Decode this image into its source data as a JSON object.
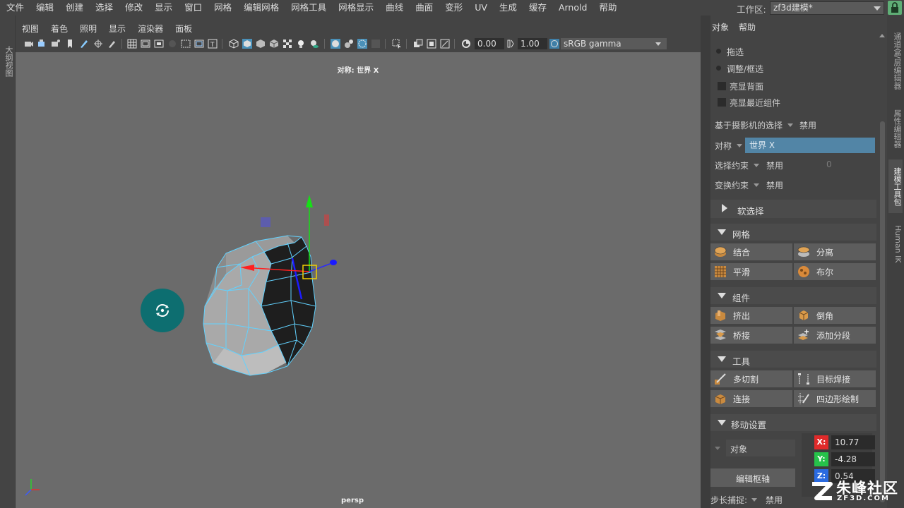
{
  "menubar": {
    "items": [
      "文件",
      "编辑",
      "创建",
      "选择",
      "修改",
      "显示",
      "窗口",
      "网格",
      "编辑网格",
      "网格工具",
      "网格显示",
      "曲线",
      "曲面",
      "变形",
      "UV",
      "生成",
      "缓存",
      "Arnold",
      "帮助"
    ],
    "workspace_label": "工作区:",
    "workspace_value": "zf3d建模*"
  },
  "left_strip": {
    "tab_label": "大纲视图"
  },
  "panel_menu": {
    "items": [
      "视图",
      "着色",
      "照明",
      "显示",
      "渲染器",
      "面板"
    ]
  },
  "toolbar": {
    "exposure_value": "0.00",
    "gamma_value": "1.00",
    "colorspace": "sRGB gamma"
  },
  "viewport": {
    "symmetry_label": "对称: 世界 X",
    "camera_name": "persp"
  },
  "right_panel": {
    "menu": [
      "对象",
      "帮助"
    ],
    "radio_drag": "拖选",
    "radio_adjust": "调整/框选",
    "check_backface": "亮显背面",
    "check_nearest": "亮显最近组件",
    "camera_selection_label": "基于摄影机的选择",
    "camera_selection_value": "禁用",
    "symmetry_label": "对称",
    "symmetry_value": "世界 X",
    "select_constraint_label": "选择约束",
    "select_constraint_value": "禁用",
    "select_constraint_num": "0",
    "transform_constraint_label": "变换约束",
    "transform_constraint_value": "禁用",
    "soft_select_label": "软选择",
    "sections": {
      "mesh": {
        "title": "网格",
        "buttons": [
          "结合",
          "分离",
          "平滑",
          "布尔"
        ]
      },
      "component": {
        "title": "组件",
        "buttons": [
          "挤出",
          "倒角",
          "桥接",
          "添加分段"
        ]
      },
      "tools": {
        "title": "工具",
        "buttons": [
          "多切割",
          "目标焊接",
          "连接",
          "四边形绘制"
        ]
      },
      "move": {
        "title": "移动设置",
        "object_label": "对象",
        "edit_pivot": "编辑枢轴",
        "step_label": "步长捕捉:",
        "step_value": "禁用"
      }
    },
    "coords": {
      "x_label": "X:",
      "x": "10.77",
      "y_label": "Y:",
      "y": "-4.28",
      "z_label": "Z:",
      "z": "0.54"
    }
  },
  "right_tabs": [
    "通道盒/层编辑器",
    "属性编辑器",
    "建模工具包",
    "Human IK"
  ],
  "watermark": {
    "main": "朱峰社区",
    "sub": "ZF3D.COM"
  },
  "colors": {
    "accent_blue": "#5285a6",
    "tumble_teal": "#0d6e70",
    "lock_green": "#5fae76",
    "wire_cyan": "#5fd8ff"
  }
}
